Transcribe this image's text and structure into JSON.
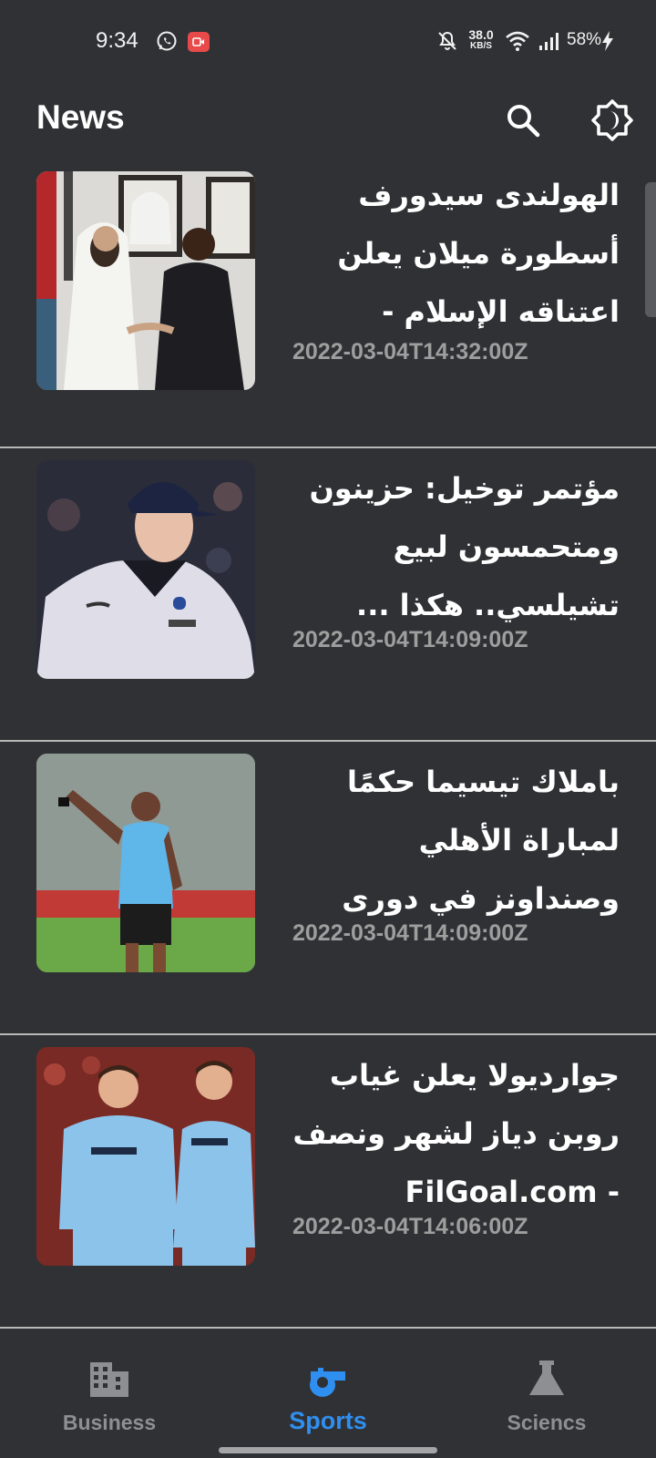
{
  "status_bar": {
    "time": "9:34",
    "net_speed_value": "38.0",
    "net_speed_unit": "KB/S",
    "battery": "58%",
    "icons": [
      "whatsapp-icon",
      "screen-record-icon",
      "mute-icon",
      "wifi-icon",
      "signal-icon",
      "charging-icon"
    ]
  },
  "app_bar": {
    "title": "News",
    "search_icon": "search-icon",
    "theme_icon": "brightness-icon"
  },
  "news": [
    {
      "title": "الهولندى سيدورف أسطورة ميلان يعلن اعتناقه الإسلام - اليو...",
      "date": "2022-03-04T14:32:00Z"
    },
    {
      "title": "مؤتمر توخيل: حزينون ومتحمسون لبيع تشيلسي.. هكذا ...",
      "date": "2022-03-04T14:09:00Z"
    },
    {
      "title": "باملاك تيسيما حكمًا لمباراة الأهلي وصنداونز في دورى الأبطال - ...",
      "date": "2022-03-04T14:09:00Z"
    },
    {
      "title": "جوارديولا يعلن غياب روبن دياز لشهر ونصف - FilGoal.com",
      "date": "2022-03-04T14:06:00Z"
    }
  ],
  "bottom_nav": {
    "tabs": [
      {
        "label": "Business",
        "icon": "building-icon",
        "active": false
      },
      {
        "label": "Sports",
        "icon": "whistle-icon",
        "active": true
      },
      {
        "label": "Sciencs",
        "icon": "flask-icon",
        "active": false
      }
    ],
    "active_color": "#2f8ff0",
    "inactive_color": "#8e8f92"
  }
}
